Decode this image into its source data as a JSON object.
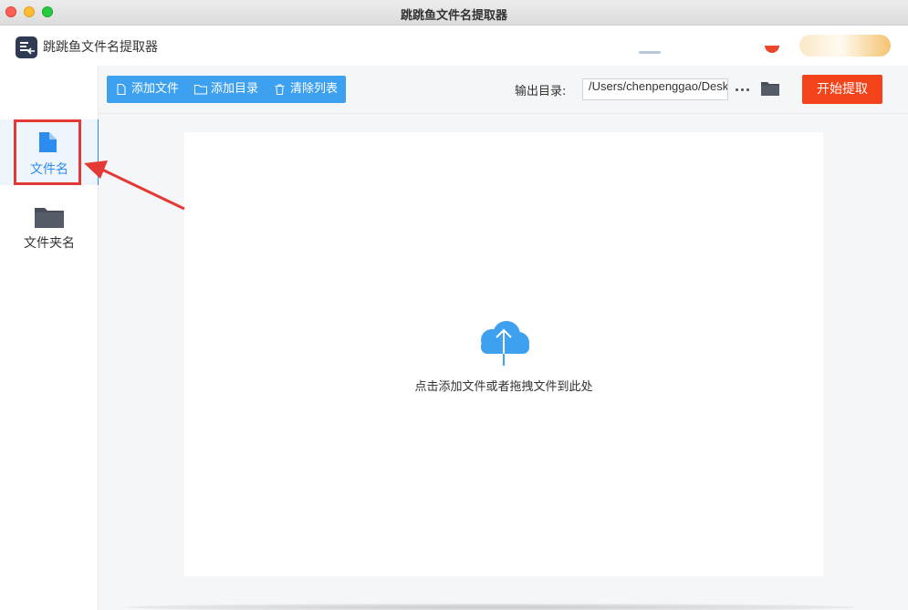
{
  "window": {
    "title": "跳跳鱼文件名提取器"
  },
  "app": {
    "name": "跳跳鱼文件名提取器"
  },
  "sidebar": {
    "items": [
      {
        "label": "文件名",
        "icon": "file-icon",
        "active": true
      },
      {
        "label": "文件夹名",
        "icon": "folder-icon",
        "active": false
      }
    ]
  },
  "toolbar": {
    "add_file_label": "添加文件",
    "add_dir_label": "添加目录",
    "clear_list_label": "清除列表",
    "output_label": "输出目录:",
    "output_path": "/Users/chenpenggao/Desktop",
    "start_label": "开始提取"
  },
  "dropzone": {
    "text": "点击添加文件或者拖拽文件到此处",
    "icon": "cloud-upload-icon"
  },
  "colors": {
    "accent": "#2d8cf0",
    "toolbar_blue": "#3ea1f0",
    "start_button": "#f2431b",
    "highlight": "#e53935"
  }
}
